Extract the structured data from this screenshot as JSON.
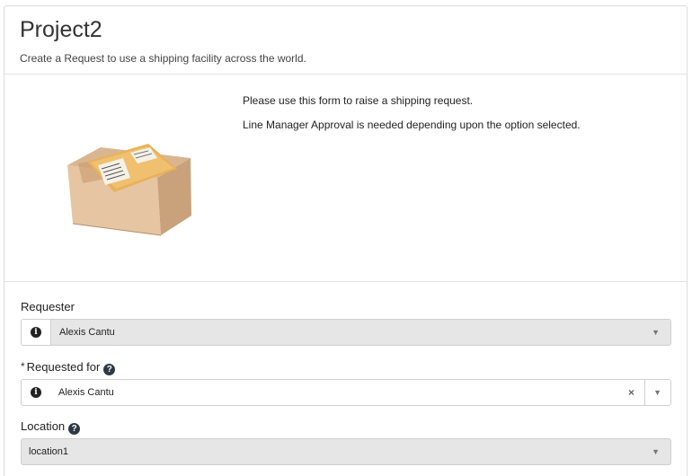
{
  "header": {
    "title": "Project2",
    "subtitle": "Create a Request to use a shipping facility across the world."
  },
  "intro": {
    "line1": "Please use this form to raise a shipping request.",
    "line2": "Line Manager Approval is needed depending upon the option selected."
  },
  "fields": {
    "requester": {
      "label": "Requester",
      "value": "Alexis Cantu",
      "disabled": true
    },
    "requested_for": {
      "required_marker": "*",
      "label": "Requested for",
      "value": "Alexis Cantu",
      "help": "?"
    },
    "location": {
      "label": "Location",
      "value": "location1",
      "help": "?"
    }
  },
  "icons": {
    "info": "i",
    "caret": "▼",
    "clear": "×"
  },
  "colors": {
    "disabled_bg": "#e6e6e6",
    "border": "#cfcfcf",
    "help_icon": "#2d3a45"
  }
}
